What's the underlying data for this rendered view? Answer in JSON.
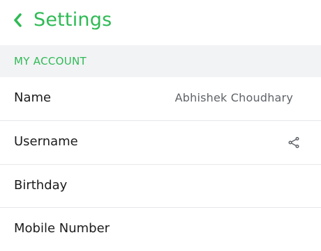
{
  "header": {
    "title": "Settings",
    "back_icon": "chevron-left-icon"
  },
  "section": {
    "label": "MY ACCOUNT"
  },
  "rows": [
    {
      "label": "Name",
      "value": "Abhishek Choudhary"
    },
    {
      "label": "Username",
      "value": "",
      "icon": "share-icon"
    },
    {
      "label": "Birthday",
      "value": ""
    },
    {
      "label": "Mobile Number",
      "value": ""
    }
  ],
  "colors": {
    "accent": "#2fba55",
    "section_bg": "#f2f3f5",
    "text": "#1c1c1e",
    "value_text": "#5f6368",
    "divider": "#e6e7ea"
  }
}
